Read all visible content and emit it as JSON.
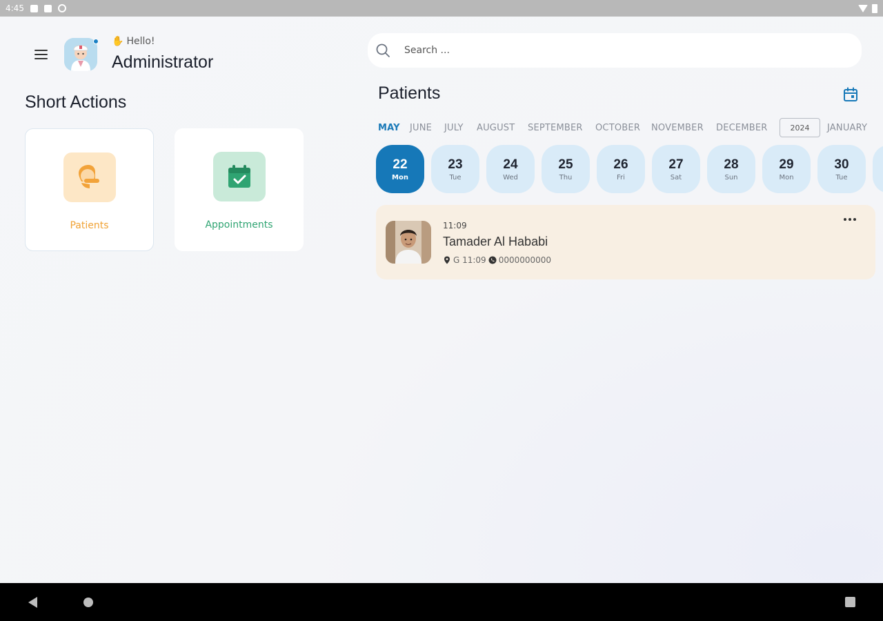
{
  "status_bar": {
    "time": "4:45"
  },
  "header": {
    "greeting": "Hello!",
    "user_name": "Administrator"
  },
  "short_actions": {
    "title": "Short Actions",
    "items": [
      {
        "label": "Patients",
        "color": "#f0a234"
      },
      {
        "label": "Appointments",
        "color": "#2fa472"
      }
    ]
  },
  "search": {
    "placeholder": "Search ..."
  },
  "patients_panel": {
    "title": "Patients",
    "months": [
      "MAY",
      "JUNE",
      "JULY",
      "AUGUST",
      "SEPTEMBER",
      "OCTOBER",
      "NOVEMBER",
      "DECEMBER",
      "2024",
      "JANUARY"
    ],
    "active_month": "MAY",
    "days": [
      {
        "num": "22",
        "dow": "Mon",
        "active": true
      },
      {
        "num": "23",
        "dow": "Tue"
      },
      {
        "num": "24",
        "dow": "Wed"
      },
      {
        "num": "25",
        "dow": "Thu"
      },
      {
        "num": "26",
        "dow": "Fri"
      },
      {
        "num": "27",
        "dow": "Sat"
      },
      {
        "num": "28",
        "dow": "Sun"
      },
      {
        "num": "29",
        "dow": "Mon"
      },
      {
        "num": "30",
        "dow": "Tue"
      }
    ],
    "appointment": {
      "time": "11:09",
      "name": "Tamader Al Hababi",
      "room": "G 11:09",
      "phone": "0000000000"
    }
  },
  "colors": {
    "accent": "#1678b8",
    "day_pill": "#d9ebf8",
    "appointment_card": "#f8efe3"
  }
}
